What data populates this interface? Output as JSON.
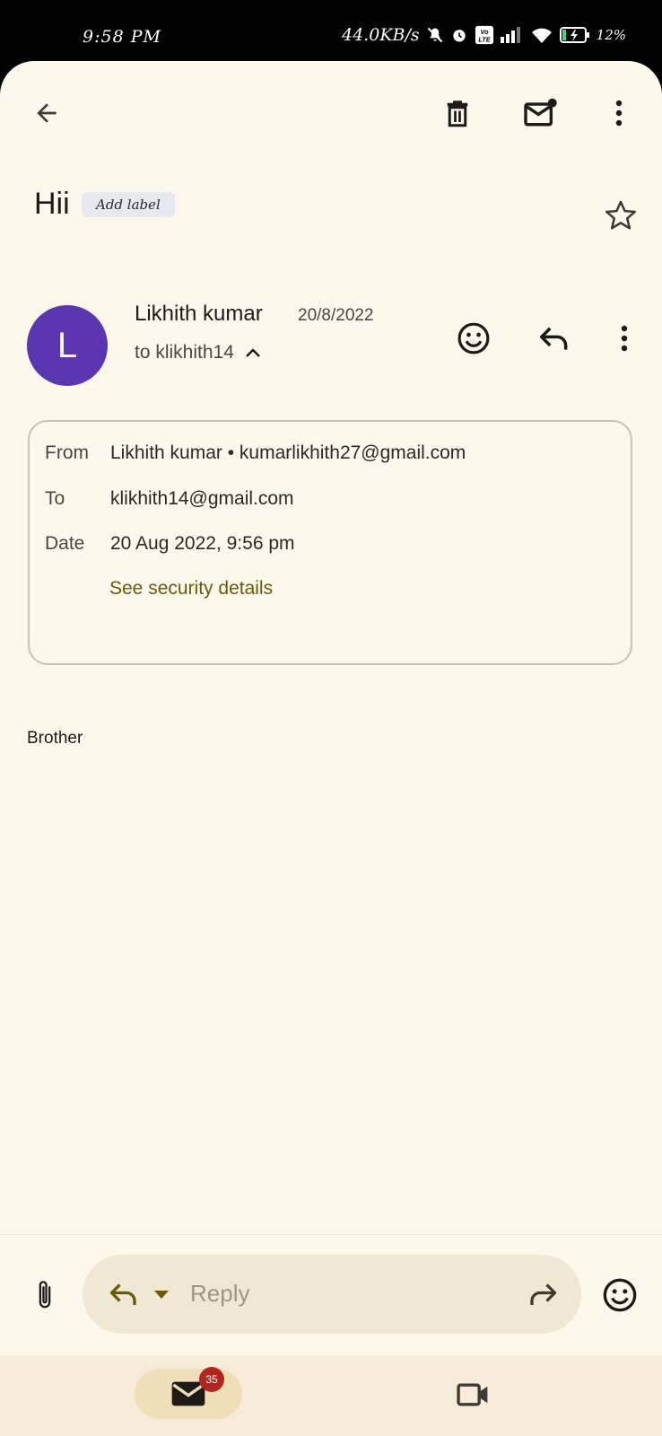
{
  "status_bar": {
    "time": "9:58 PM",
    "network_speed": "44.0KB/s",
    "battery": "12%",
    "volte": "Vo\nLTE"
  },
  "toolbar": {
    "back_icon": "arrow-left-icon",
    "delete_icon": "trash-icon",
    "mark_unread_icon": "mail-unread-icon",
    "more_icon": "more-vert-icon"
  },
  "email": {
    "subject": "Hii",
    "add_label": "Add label",
    "sender_initial": "L",
    "sender_name": "Likhith kumar",
    "date_short": "20/8/2022",
    "to_line": "to klikhith14",
    "details": {
      "from_label": "From",
      "from_value": "Likhith kumar • kumarlikhith27@gmail.com",
      "to_label": "To",
      "to_value": "klikhith14@gmail.com",
      "date_label": "Date",
      "date_value": "20 Aug 2022, 9:56 pm",
      "security_link": "See security details"
    },
    "body": "Brother"
  },
  "reply_bar": {
    "placeholder": "Reply"
  },
  "bottom_nav": {
    "mail_badge": "35"
  },
  "colors": {
    "background": "#fdf8ec",
    "avatar": "#5c35b0",
    "link": "#6b5a05",
    "badge": "#b3261e"
  }
}
